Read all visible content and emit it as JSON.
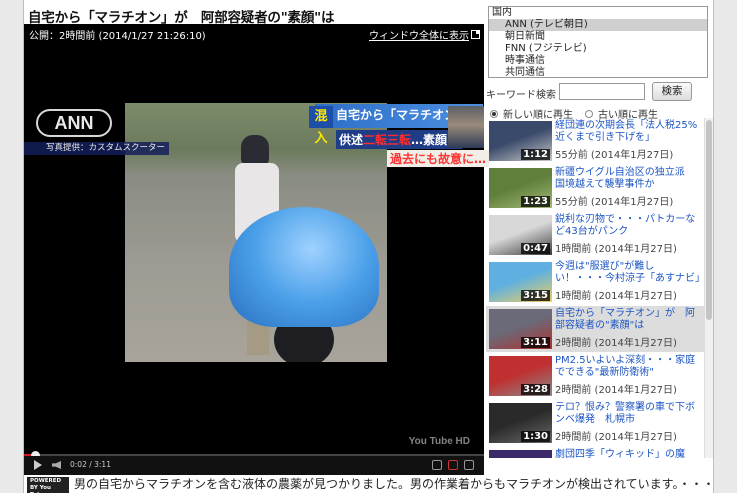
{
  "title": "自宅から「マラチオン」が　阿部容疑者の\"素顔\"は",
  "player": {
    "published": "公開：2時間前 (2014/1/27 21:26:10)",
    "fullwindow_label": "ウィンドウ全体に表示",
    "ann_logo": "ANN",
    "ann_caption": "写真提供：カスタムスクーター",
    "banner_tag": "混入",
    "banner_line1": "自宅から「マラチオン」",
    "banner_line2a": "供述",
    "banner_line2b": "二転三転",
    "banner_line2c": "…素顔は",
    "banner_line3": "過去にも故意に…",
    "time_display": "0:02 / 3:11",
    "progress_fraction": 0.02,
    "watermark": "You Tube HD"
  },
  "powered_by": "POWERED BY You Tube",
  "description": "男の自宅からマラチオンを含む液体の農薬が見つかりました。男の作業着からもマラチオンが検出されています。・・・",
  "categories": {
    "options": [
      {
        "label": "国内",
        "head": true,
        "selected": false
      },
      {
        "label": "ANN (テレビ朝日)",
        "head": false,
        "selected": true
      },
      {
        "label": "朝日新聞",
        "head": false,
        "selected": false
      },
      {
        "label": "FNN (フジテレビ)",
        "head": false,
        "selected": false
      },
      {
        "label": "時事通信",
        "head": false,
        "selected": false
      },
      {
        "label": "共同通信",
        "head": false,
        "selected": false
      }
    ]
  },
  "search": {
    "label": "キーワード検索",
    "value": "",
    "button": "検索"
  },
  "sort": {
    "newest": "新しい順に再生",
    "oldest": "古い順に再生"
  },
  "videos": [
    {
      "title": "経団連の次期会長「法人税25%近くまで引き下げを」",
      "time": "55分前 (2014年1月27日)",
      "duration": "1:12",
      "colors": [
        "#3a4a6a",
        "#c9c9c9"
      ],
      "active": false
    },
    {
      "title": "新疆ウイグル自治区の独立派　国境越えて襲撃事件か",
      "time": "55分前 (2014年1月27日)",
      "duration": "1:23",
      "colors": [
        "#5f7f3a",
        "#a6b97a"
      ],
      "active": false
    },
    {
      "title": "鋭利な刃物で・・・パトカーなど43台がパンク",
      "time": "1時間前 (2014年1月27日)",
      "duration": "0:47",
      "colors": [
        "#d8d8d8",
        "#3a3a3a"
      ],
      "active": false
    },
    {
      "title": "今週は\"服選び\"が難しい！・・・今村涼子「あすナビ」",
      "time": "1時間前 (2014年1月27日)",
      "duration": "3:15",
      "colors": [
        "#5fb0e0",
        "#f0d060"
      ],
      "active": false
    },
    {
      "title": "自宅から「マラチオン」が　阿部容疑者の\"素顔\"は",
      "time": "2時間前 (2014年1月27日)",
      "duration": "3:11",
      "colors": [
        "#6a6a78",
        "#b03030"
      ],
      "active": true
    },
    {
      "title": "PM2.5いよいよ深刻・・・家庭でできる\"最新防衛術\"",
      "time": "2時間前 (2014年1月27日)",
      "duration": "3:28",
      "colors": [
        "#c03030",
        "#8a8a8a"
      ],
      "active": false
    },
    {
      "title": "テロ？恨み？警察署の車で下ボンベ爆発　札幌市",
      "time": "2時間前 (2014年1月27日)",
      "duration": "1:30",
      "colors": [
        "#2a2a2a",
        "#6a6a6a"
      ],
      "active": false
    },
    {
      "title": "劇団四季「ウィキッド」の魔女、視聴履歴を消去",
      "time": "",
      "duration": "",
      "colors": [
        "#3a2a6a",
        "#888"
      ],
      "active": false
    }
  ]
}
